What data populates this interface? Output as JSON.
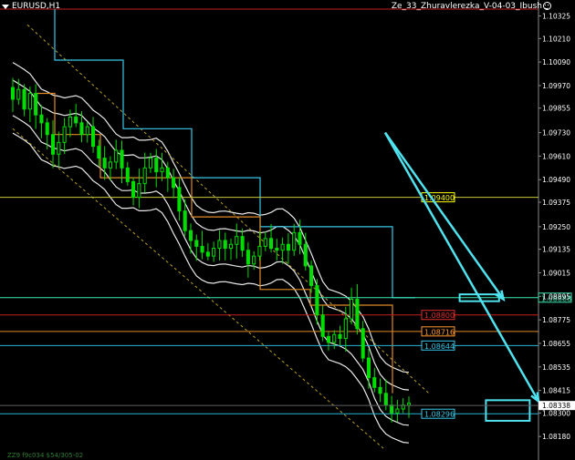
{
  "header": {
    "symbol": "EURUSD,H1",
    "indicator": "Ze_33_Zhuravlerezka_V-04-03_Ibush",
    "smiley_icon": "smiley-icon"
  },
  "footer": {
    "text": "ZZ9 f9c034 $54/305-02"
  },
  "colors": {
    "background": "#000000",
    "candles": "#00dd00",
    "axis_text": "#ffffff",
    "arrow": "#4fe3f0"
  },
  "chart_data": {
    "type": "candlestick",
    "y_axis": {
      "position": "right",
      "range": [
        1.0806,
        1.1036
      ],
      "ticks": [
        "1.10325",
        "1.10210",
        "1.10090",
        "1.09970",
        "1.09855",
        "1.09730",
        "1.09610",
        "1.09490",
        "1.09375",
        "1.09250",
        "1.09135",
        "1.09015",
        "1.08895",
        "1.08775",
        "1.08655",
        "1.08535",
        "1.08415",
        "1.08300",
        "1.08180"
      ]
    },
    "close_series": [
      1.099,
      1.0995,
      1.0985,
      1.0993,
      1.0982,
      1.0978,
      1.0972,
      1.0962,
      1.0968,
      1.0976,
      1.0981,
      1.0978,
      1.0972,
      1.0976,
      1.0966,
      1.096,
      1.0955,
      1.0958,
      1.0964,
      1.0955,
      1.0948,
      1.094,
      1.0947,
      1.0955,
      1.096,
      1.0953,
      1.0955,
      1.095,
      1.0945,
      1.0933,
      1.0923,
      1.0918,
      1.0915,
      1.0912,
      1.091,
      1.0914,
      1.0918,
      1.0914,
      1.0916,
      1.092,
      1.0913,
      1.0906,
      1.091,
      1.0915,
      1.0919,
      1.0914,
      1.0913,
      1.0916,
      1.0913,
      1.0922,
      1.0916,
      1.0905,
      1.0895,
      1.088,
      1.0869,
      1.0866,
      1.087,
      1.0868,
      1.0878,
      1.0888,
      1.0873,
      1.0858,
      1.0848,
      1.0843,
      1.084,
      1.0834,
      1.083,
      1.0832,
      1.0834,
      1.0835
    ],
    "price_levels": [
      {
        "label": "1.09400",
        "value": 1.094,
        "color": "#c8c83c",
        "label_color": "#ffff00"
      },
      {
        "label": "1.08888",
        "value": 1.08888,
        "color": "#3ce8b4",
        "label_color": "#3ce8b4"
      },
      {
        "label": "1.08800",
        "value": 1.088,
        "color": "#c81e1e",
        "label_color": "#e03030"
      },
      {
        "label": "1.08716",
        "value": 1.08716,
        "color": "#e08a28",
        "label_color": "#ff9a30"
      },
      {
        "label": "1.08644",
        "value": 1.08644,
        "color": "#28b4d2",
        "label_color": "#38c8e8"
      },
      {
        "label": "1.08296",
        "value": 1.08296,
        "color": "#28b4d2",
        "label_color": "#38c8e8"
      }
    ],
    "current_price": {
      "label": "1.08338",
      "value": 1.08338
    },
    "top_line": {
      "value": 1.1036,
      "color": "#c81e1e"
    },
    "arrows": [
      {
        "from": [
          85,
          1.0973
        ],
        "to": [
          112,
          1.0888
        ]
      },
      {
        "from": [
          85,
          1.0973
        ],
        "to": [
          120,
          1.0836
        ]
      }
    ],
    "boxes": [
      {
        "x": [
          102,
          111
        ],
        "y": [
          1.08905,
          1.0887
        ]
      },
      {
        "x": [
          108,
          118
        ],
        "y": [
          1.08365,
          1.0826
        ]
      }
    ]
  }
}
